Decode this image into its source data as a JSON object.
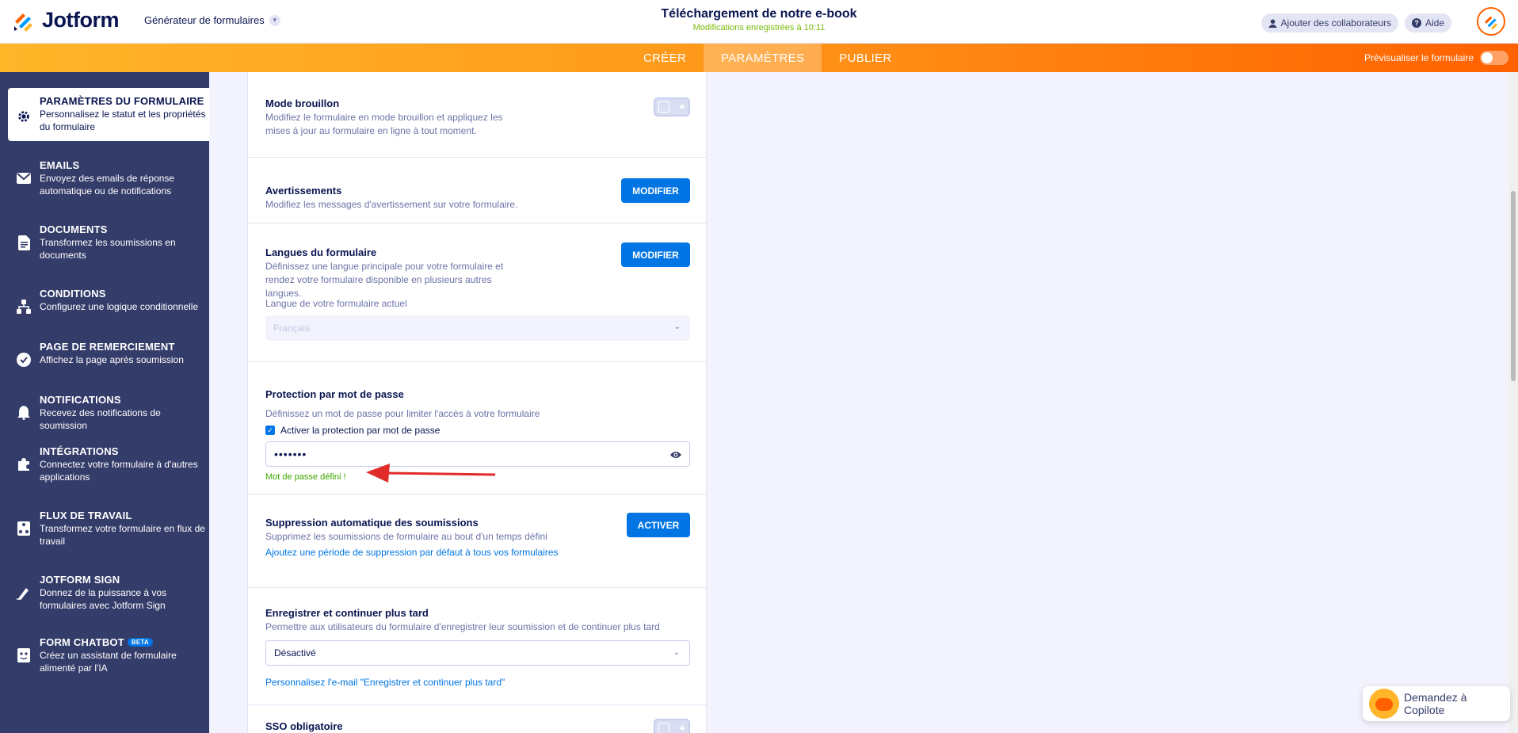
{
  "header": {
    "logo_text": "Jotform",
    "builder_label": "Générateur de formulaires",
    "form_title": "Téléchargement de notre e-book",
    "save_status": "Modifications enregistrées à 10:11",
    "add_collaborators": "Ajouter des collaborateurs",
    "help": "Aide"
  },
  "nav": {
    "tabs": [
      "CRÉER",
      "PARAMÈTRES",
      "PUBLIER"
    ],
    "active_tab": "PARAMÈTRES",
    "preview_label": "Prévisualiser le formulaire"
  },
  "sidebar": {
    "items": [
      {
        "title": "PARAMÈTRES DU FORMULAIRE",
        "desc": "Personnalisez le statut et les propriétés du formulaire",
        "icon": "gear-icon"
      },
      {
        "title": "EMAILS",
        "desc": "Envoyez des emails de réponse automatique ou de notifications",
        "icon": "envelope-icon"
      },
      {
        "title": "DOCUMENTS",
        "desc": "Transformez les soumissions en documents",
        "icon": "document-icon"
      },
      {
        "title": "CONDITIONS",
        "desc": "Configurez une logique conditionnelle",
        "icon": "hierarchy-icon"
      },
      {
        "title": "PAGE DE REMERCIEMENT",
        "desc": "Affichez la page après soumission",
        "icon": "check-circle-icon"
      },
      {
        "title": "NOTIFICATIONS",
        "desc": "Recevez des notifications de soumission",
        "icon": "bell-icon"
      },
      {
        "title": "INTÉGRATIONS",
        "desc": "Connectez votre formulaire à d'autres applications",
        "icon": "puzzle-icon"
      },
      {
        "title": "FLUX DE TRAVAIL",
        "desc": "Transformez votre formulaire en flux de travail",
        "icon": "workflow-icon"
      },
      {
        "title": "JOTFORM SIGN",
        "desc": "Donnez de la puissance à vos formulaires avec Jotform Sign",
        "icon": "pen-icon"
      },
      {
        "title": "FORM CHATBOT",
        "badge": "BETA",
        "desc": "Créez un assistant de formulaire alimenté par l'IA",
        "icon": "chatbot-icon"
      }
    ]
  },
  "settings": {
    "draft": {
      "title": "Mode brouillon",
      "desc": "Modifiez le formulaire en mode brouillon et appliquez les mises à jour au formulaire en ligne à tout moment."
    },
    "warnings": {
      "title": "Avertissements",
      "desc": "Modifiez les messages d'avertissement sur votre formulaire.",
      "button": "MODIFIER"
    },
    "languages": {
      "title": "Langues du formulaire",
      "desc": "Définissez une langue principale pour votre formulaire et rendez votre formulaire disponible en plusieurs autres langues.",
      "button": "MODIFIER",
      "current_label": "Langue de votre formulaire actuel",
      "current_value": "Français"
    },
    "password": {
      "title": "Protection par mot de passe",
      "desc": "Définissez un mot de passe pour limiter l'accès à votre formulaire",
      "checkbox_label": "Activer la protection par mot de passe",
      "masked_value": "•••••••",
      "success": "Mot de passe défini !"
    },
    "auto_delete": {
      "title": "Suppression automatique des soumissions",
      "desc": "Supprimez les soumissions de formulaire au bout d'un temps défini",
      "button": "ACTIVER",
      "link": "Ajoutez une période de suppression par défaut à tous vos formulaires"
    },
    "save_later": {
      "title": "Enregistrer et continuer plus tard",
      "desc": "Permettre aux utilisateurs du formulaire d'enregistrer leur soumission et de continuer plus tard",
      "value": "Désactivé",
      "link": "Personnalisez l'e-mail \"Enregistrer et continuer plus tard\""
    },
    "sso": {
      "title": "SSO obligatoire"
    }
  },
  "copilot": {
    "label": "Demandez à Copilote"
  },
  "colors": {
    "accent": "#0075e3",
    "brand_orange": "#ff6100",
    "sidebar": "#343c6a",
    "success": "#3fa700"
  }
}
